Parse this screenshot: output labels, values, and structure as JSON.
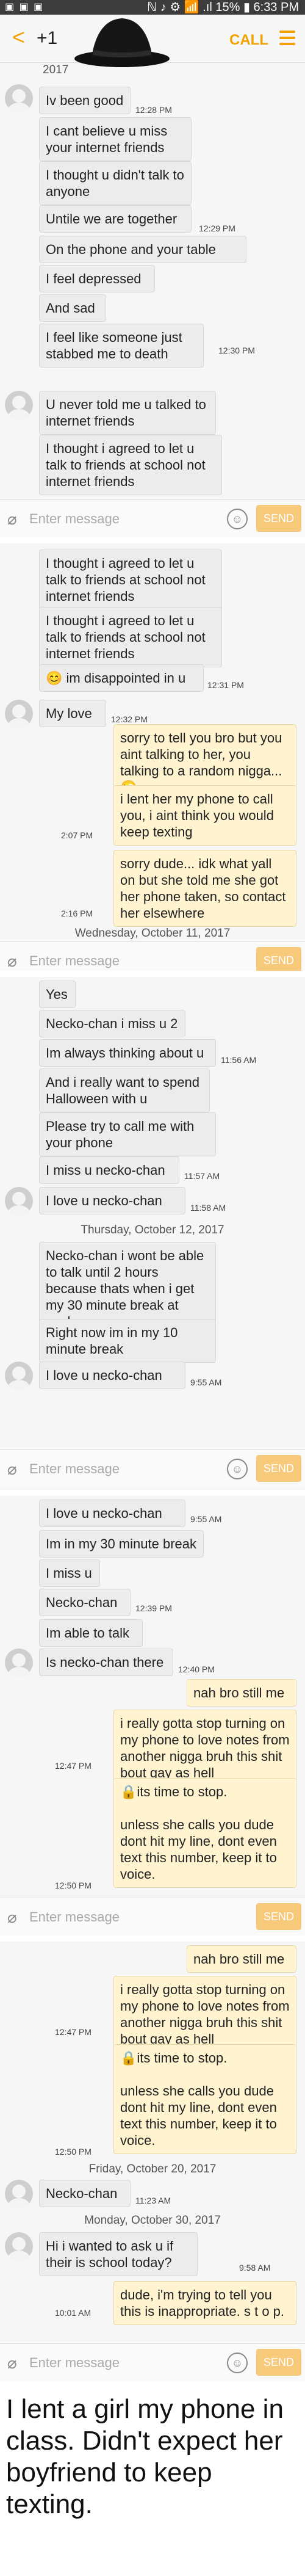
{
  "status_bar": {
    "left_icons": "▣ ▣ ▣",
    "right": "ℕ ♪ ⚙ 📶 .ıl 15% ▮ 6:33 PM"
  },
  "top_bar": {
    "back": "<",
    "contact": "+1",
    "call": "CALL"
  },
  "composer": {
    "placeholder": "Enter message",
    "send": "SEND",
    "attach_icon": "paperclip-icon",
    "emoji_icon": "emoji-icon"
  },
  "panels": [
    {
      "messages": [
        {
          "dir": "in",
          "text": "2017",
          "time": ""
        },
        {
          "dir": "in",
          "text": "Iv been good",
          "time": "12:28 PM"
        },
        {
          "dir": "in",
          "text": "I cant believe u miss your internet friends",
          "time": ""
        },
        {
          "dir": "in",
          "text": "I thought u didn't talk to anyone",
          "time": ""
        },
        {
          "dir": "in",
          "text": "Untile we are together",
          "time": "12:29 PM"
        },
        {
          "dir": "in",
          "text": "On the phone and your table",
          "time": ""
        },
        {
          "dir": "in",
          "text": "I feel depressed",
          "time": ""
        },
        {
          "dir": "in",
          "text": "And sad",
          "time": ""
        },
        {
          "dir": "in",
          "text": "I feel like someone just stabbed me to death",
          "time": "12:30 PM"
        },
        {
          "dir": "in",
          "text": "U never told me u talked to internet friends",
          "time": ""
        },
        {
          "dir": "in",
          "text": "I thought i agreed to let u talk to friends at school not internet friends",
          "time": ""
        }
      ]
    },
    {
      "messages": [
        {
          "dir": "in",
          "text": "I thought i agreed to let u talk to friends at school not internet friends",
          "time": ""
        },
        {
          "dir": "in",
          "text": "I thought i agreed to let u talk to friends at school not internet friends",
          "time": ""
        },
        {
          "dir": "in",
          "text": "😊 im disappointed in u",
          "time": "12:31 PM"
        },
        {
          "dir": "in",
          "text": "My love",
          "time": "12:32 PM"
        },
        {
          "dir": "out",
          "text": "sorry to tell you bro but you aint talking to her, you talking to a random nigga... 😜",
          "time": ""
        },
        {
          "dir": "out",
          "text": "i lent her my phone to call you, i aint think you would keep texting",
          "time": "2:07 PM"
        },
        {
          "dir": "out",
          "text": "sorry dude... idk what yall on but she told me she got her phone taken, so contact her elsewhere",
          "time": "2:16 PM"
        }
      ],
      "date": "Wednesday, October 11, 2017"
    },
    {
      "messages": [
        {
          "dir": "in",
          "text": "Yes",
          "time": ""
        },
        {
          "dir": "in",
          "text": "Necko-chan i miss u 2",
          "time": ""
        },
        {
          "dir": "in",
          "text": "Im always thinking about u",
          "time": "11:56 AM"
        },
        {
          "dir": "in",
          "text": "And i really want to spend Halloween with u",
          "time": ""
        },
        {
          "dir": "in",
          "text": "Please try to call me with your phone",
          "time": ""
        },
        {
          "dir": "in",
          "text": "I miss u necko-chan",
          "time": "11:57 AM"
        },
        {
          "dir": "in",
          "text": "I love u necko-chan",
          "time": "11:58 AM"
        }
      ],
      "date": "Thursday, October 12, 2017",
      "after": [
        {
          "dir": "in",
          "text": "Necko-chan i wont be able to talk until 2 hours because thats when i get my 30 minute break at work",
          "time": ""
        },
        {
          "dir": "in",
          "text": "Right now im in my 10 minute break",
          "time": ""
        },
        {
          "dir": "in",
          "text": "I love u necko-chan",
          "time": "9:55 AM"
        }
      ]
    },
    {
      "messages": [
        {
          "dir": "in",
          "text": "I love u necko-chan",
          "time": "9:55 AM"
        },
        {
          "dir": "in",
          "text": "Im in my 30 minute break",
          "time": ""
        },
        {
          "dir": "in",
          "text": "I miss u",
          "time": ""
        },
        {
          "dir": "in",
          "text": "Necko-chan",
          "time": "12:39 PM"
        },
        {
          "dir": "in",
          "text": "Im able to talk",
          "time": ""
        },
        {
          "dir": "in",
          "text": "Is necko-chan there",
          "time": "12:40 PM"
        },
        {
          "dir": "out",
          "text": "nah bro still me",
          "time": ""
        },
        {
          "dir": "out",
          "text": "i really gotta stop turning on my phone to love notes from another nigga bruh this shit bout gay as hell",
          "time": "12:47 PM"
        },
        {
          "dir": "out",
          "text": "🔒its time to stop.\n\nunless she calls you dude dont hit my line, dont even text this number, keep it to voice.",
          "time": "12:50 PM"
        }
      ]
    },
    {
      "messages": [
        {
          "dir": "out",
          "text": "nah bro still me",
          "time": ""
        },
        {
          "dir": "out",
          "text": "i really gotta stop turning on my phone to love notes from another nigga bruh this shit bout gay as hell",
          "time": "12:47 PM"
        },
        {
          "dir": "out",
          "text": "🔒its time to stop.\n\nunless she calls you dude dont hit my line, dont even text this number, keep it to voice.",
          "time": "12:50 PM"
        }
      ],
      "date": "Friday, October 20, 2017",
      "after": [
        {
          "dir": "in",
          "text": "Necko-chan",
          "time": "11:23 AM"
        }
      ],
      "date2": "Monday, October 30, 2017",
      "after2": [
        {
          "dir": "in",
          "text": "Hi i wanted to ask u if their is school today?",
          "time": "9:58 AM"
        },
        {
          "dir": "out",
          "text": "dude, i'm trying to tell you this is inappropriate. s t o p.",
          "time": "10:01 AM"
        }
      ]
    }
  ],
  "caption": "I lent a girl my phone in class. Didn't expect her boyfriend to keep texting."
}
